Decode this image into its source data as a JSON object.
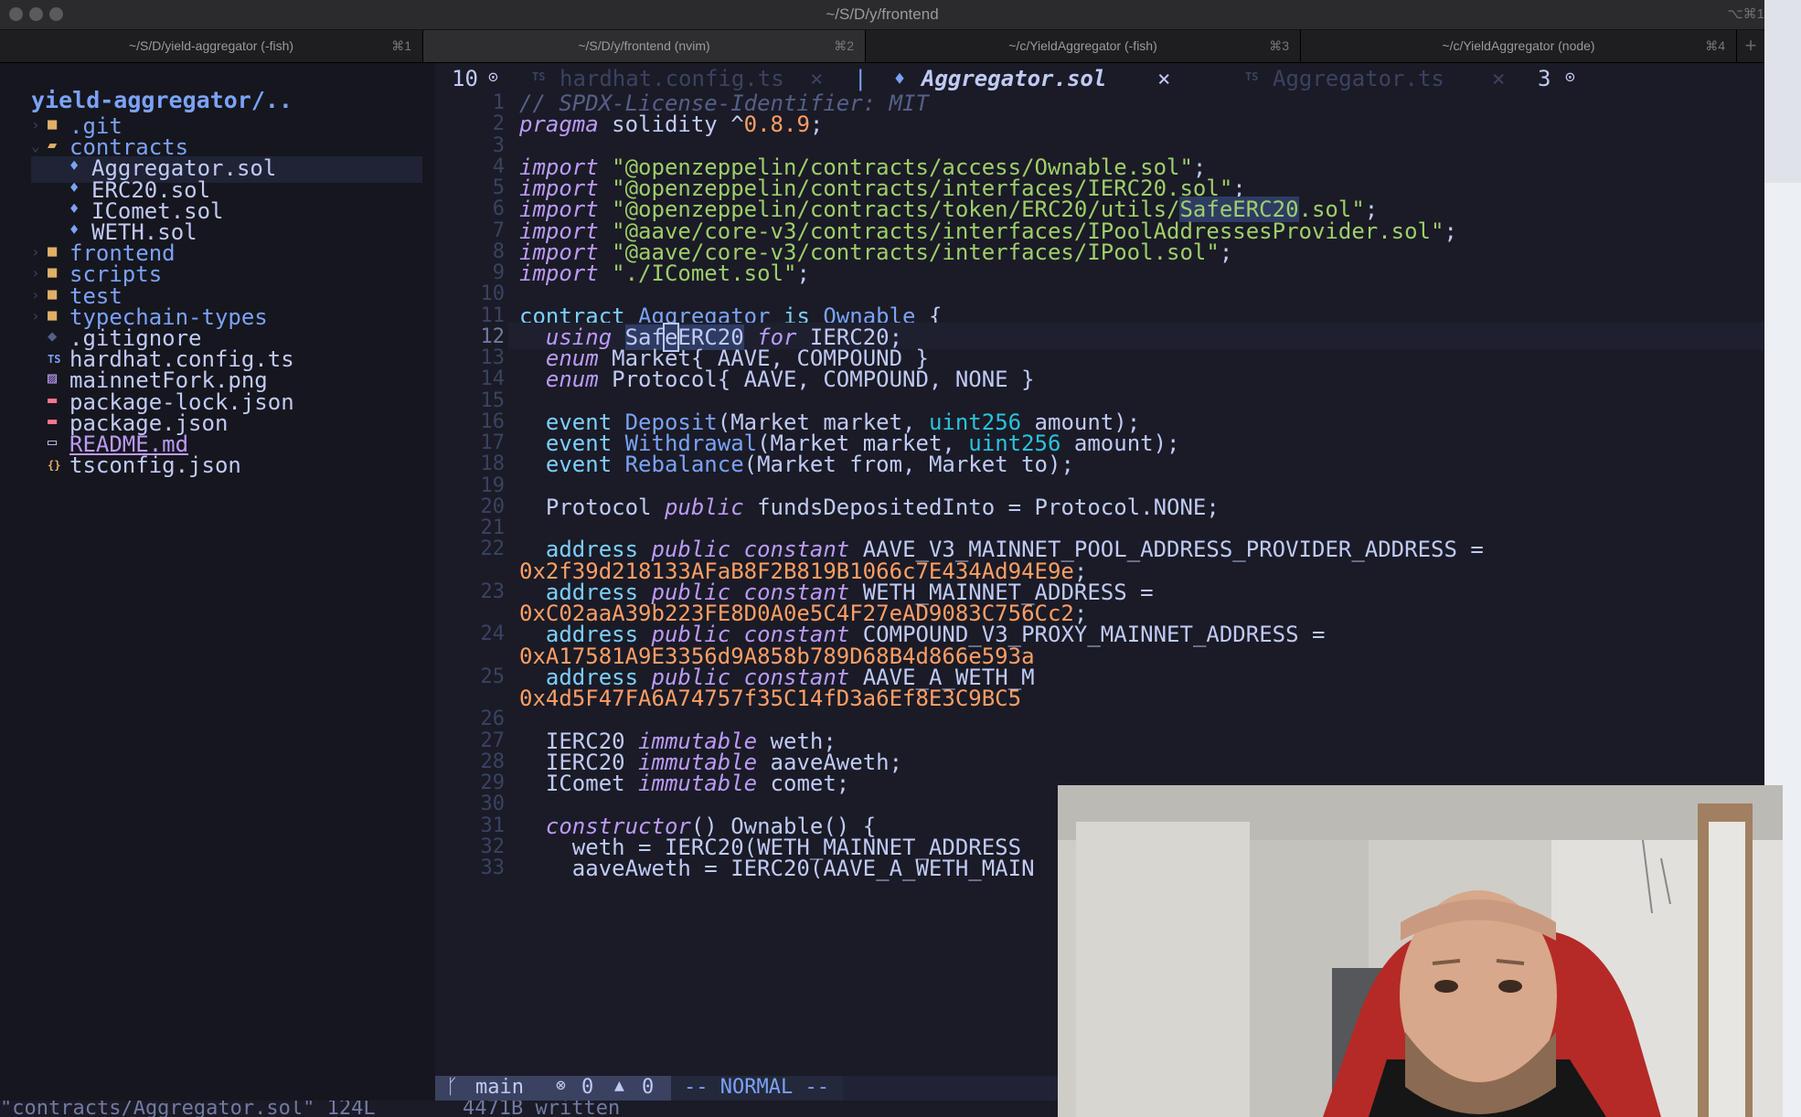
{
  "window": {
    "title": "~/S/D/y/frontend",
    "shortcut": "⌥⌘1"
  },
  "terminal_tabs": [
    {
      "label": "~/S/D/yield-aggregator (-fish)",
      "key": "⌘1"
    },
    {
      "label": "~/S/D/y/frontend (nvim)",
      "key": "⌘2"
    },
    {
      "label": "~/c/YieldAggregator (-fish)",
      "key": "⌘3"
    },
    {
      "label": "~/c/YieldAggregator (node)",
      "key": "⌘4"
    }
  ],
  "new_tab": "+",
  "sidebar": {
    "root": "yield-aggregator/..",
    "items": [
      {
        "name": ".git",
        "type": "folder",
        "chev": "›"
      },
      {
        "name": "contracts",
        "type": "folder-open",
        "chev": "⌄"
      },
      {
        "name": "Aggregator.sol",
        "type": "sol",
        "selected": true
      },
      {
        "name": "ERC20.sol",
        "type": "sol"
      },
      {
        "name": "IComet.sol",
        "type": "sol"
      },
      {
        "name": "WETH.sol",
        "type": "sol"
      },
      {
        "name": "frontend",
        "type": "folder",
        "chev": "›"
      },
      {
        "name": "scripts",
        "type": "folder",
        "chev": "›"
      },
      {
        "name": "test",
        "type": "folder",
        "chev": "›"
      },
      {
        "name": "typechain-types",
        "type": "folder",
        "chev": "›"
      },
      {
        "name": ".gitignore",
        "type": "git"
      },
      {
        "name": "hardhat.config.ts",
        "type": "ts"
      },
      {
        "name": "mainnetFork.png",
        "type": "png"
      },
      {
        "name": "package-lock.json",
        "type": "npm"
      },
      {
        "name": "package.json",
        "type": "npm"
      },
      {
        "name": "README.md",
        "type": "md"
      },
      {
        "name": "tsconfig.json",
        "type": "json"
      }
    ]
  },
  "buffers": {
    "left_count": "10",
    "left_icon": "arrow-circle-icon",
    "tab1": {
      "icon": "TS",
      "name": "hardhat.config.ts",
      "close": "×"
    },
    "tab2": {
      "name": "Aggregator.sol",
      "close": "×"
    },
    "tab3": {
      "icon": "TS",
      "name": "Aggregator.ts",
      "close": "×"
    },
    "right_count": "3",
    "separator": "|"
  },
  "code": {
    "current_line": 12,
    "lines": [
      {
        "n": "1",
        "segs": [
          [
            "cm",
            "// SPDX-License-Identifier: MIT"
          ]
        ]
      },
      {
        "n": "2",
        "segs": [
          [
            "kw",
            "pragma"
          ],
          [
            "",
            " solidity ^"
          ],
          [
            "num",
            "0.8.9"
          ],
          [
            "",
            ";"
          ]
        ]
      },
      {
        "n": "3",
        "segs": []
      },
      {
        "n": "4",
        "segs": [
          [
            "kw",
            "import"
          ],
          [
            "",
            " "
          ],
          [
            "str",
            "\"@openzeppelin/contracts/access/Ownable.sol\""
          ],
          [
            "",
            ";"
          ]
        ]
      },
      {
        "n": "5",
        "segs": [
          [
            "kw",
            "import"
          ],
          [
            "",
            " "
          ],
          [
            "str",
            "\"@openzeppelin/contracts/interfaces/IERC20.sol\""
          ],
          [
            "",
            ";"
          ]
        ]
      },
      {
        "n": "6",
        "segs": [
          [
            "kw",
            "import"
          ],
          [
            "",
            " "
          ],
          [
            "str",
            "\"@openzeppelin/contracts/token/ERC20/utils/"
          ],
          [
            "str hl",
            "SafeERC20"
          ],
          [
            "str",
            ".sol\""
          ],
          [
            "",
            ";"
          ]
        ]
      },
      {
        "n": "7",
        "segs": [
          [
            "kw",
            "import"
          ],
          [
            "",
            " "
          ],
          [
            "str",
            "\"@aave/core-v3/contracts/interfaces/IPoolAddressesProvider.sol\""
          ],
          [
            "",
            ";"
          ]
        ]
      },
      {
        "n": "8",
        "segs": [
          [
            "kw",
            "import"
          ],
          [
            "",
            " "
          ],
          [
            "str",
            "\"@aave/core-v3/contracts/interfaces/IPool.sol\""
          ],
          [
            "",
            ";"
          ]
        ]
      },
      {
        "n": "9",
        "segs": [
          [
            "kw",
            "import"
          ],
          [
            "",
            " "
          ],
          [
            "str",
            "\"./IComet.sol\""
          ],
          [
            "",
            ";"
          ]
        ]
      },
      {
        "n": "10",
        "segs": []
      },
      {
        "n": "11",
        "segs": [
          [
            "kw2",
            "contract"
          ],
          [
            "",
            " "
          ],
          [
            "ev",
            "Aggregator"
          ],
          [
            "",
            " "
          ],
          [
            "kw2",
            "is"
          ],
          [
            "",
            " "
          ],
          [
            "ev",
            "Ownable"
          ],
          [
            "",
            " {"
          ]
        ]
      },
      {
        "n": "12",
        "segs": [
          [
            "",
            "  "
          ],
          [
            "kw",
            "using"
          ],
          [
            "",
            " "
          ],
          [
            "hl",
            "Saf"
          ],
          [
            "hl cursor",
            "e"
          ],
          [
            "hl",
            "ERC20"
          ],
          [
            "",
            " "
          ],
          [
            "kw",
            "for"
          ],
          [
            "",
            " IERC20;"
          ]
        ]
      },
      {
        "n": "13",
        "segs": [
          [
            "",
            "  "
          ],
          [
            "kw",
            "enum"
          ],
          [
            "",
            " Market{ AAVE, COMPOUND }"
          ]
        ]
      },
      {
        "n": "14",
        "segs": [
          [
            "",
            "  "
          ],
          [
            "kw",
            "enum"
          ],
          [
            "",
            " Protocol{ AAVE, COMPOUND, NONE }"
          ]
        ]
      },
      {
        "n": "15",
        "segs": []
      },
      {
        "n": "16",
        "segs": [
          [
            "",
            "  "
          ],
          [
            "kw2",
            "event"
          ],
          [
            "",
            " "
          ],
          [
            "ev",
            "Deposit"
          ],
          [
            "",
            "(Market market, "
          ],
          [
            "ty",
            "uint256"
          ],
          [
            "",
            " amount);"
          ]
        ]
      },
      {
        "n": "17",
        "segs": [
          [
            "",
            "  "
          ],
          [
            "kw2",
            "event"
          ],
          [
            "",
            " "
          ],
          [
            "ev",
            "Withdrawal"
          ],
          [
            "",
            "(Market market, "
          ],
          [
            "ty",
            "uint256"
          ],
          [
            "",
            " amount);"
          ]
        ]
      },
      {
        "n": "18",
        "segs": [
          [
            "",
            "  "
          ],
          [
            "kw2",
            "event"
          ],
          [
            "",
            " "
          ],
          [
            "ev",
            "Rebalance"
          ],
          [
            "",
            "(Market from, Market to);"
          ]
        ]
      },
      {
        "n": "19",
        "segs": []
      },
      {
        "n": "20",
        "segs": [
          [
            "",
            "  Protocol "
          ],
          [
            "kw",
            "public"
          ],
          [
            "",
            " fundsDepositedInto = Protocol.NONE;"
          ]
        ]
      },
      {
        "n": "21",
        "segs": []
      },
      {
        "n": "22",
        "segs": [
          [
            "",
            "  "
          ],
          [
            "kw2",
            "address"
          ],
          [
            "",
            " "
          ],
          [
            "kw",
            "public constant"
          ],
          [
            "",
            " AAVE_V3_MAINNET_POOL_ADDRESS_PROVIDER_ADDRESS ="
          ]
        ]
      },
      {
        "n": "",
        "segs": [
          [
            "num",
            "0x2f39d218133AFaB8F2B819B1066c7E434Ad94E9e"
          ],
          [
            "",
            ";"
          ]
        ]
      },
      {
        "n": "23",
        "segs": [
          [
            "",
            "  "
          ],
          [
            "kw2",
            "address"
          ],
          [
            "",
            " "
          ],
          [
            "kw",
            "public constant"
          ],
          [
            "",
            " WETH_MAINNET_ADDRESS ="
          ]
        ]
      },
      {
        "n": "",
        "segs": [
          [
            "num",
            "0xC02aaA39b223FE8D0A0e5C4F27eAD9083C756Cc2"
          ],
          [
            "",
            ";"
          ]
        ]
      },
      {
        "n": "24",
        "segs": [
          [
            "",
            "  "
          ],
          [
            "kw2",
            "address"
          ],
          [
            "",
            " "
          ],
          [
            "kw",
            "public constant"
          ],
          [
            "",
            " COMPOUND_V3_PROXY_MAINNET_ADDRESS ="
          ]
        ]
      },
      {
        "n": "",
        "segs": [
          [
            "num",
            "0xA17581A9E3356d9A858b789D68B4d866e593a"
          ]
        ]
      },
      {
        "n": "25",
        "segs": [
          [
            "",
            "  "
          ],
          [
            "kw2",
            "address"
          ],
          [
            "",
            " "
          ],
          [
            "kw",
            "public constant"
          ],
          [
            "",
            " AAVE_A_WETH_M"
          ]
        ]
      },
      {
        "n": "",
        "segs": [
          [
            "num",
            "0x4d5F47FA6A74757f35C14fD3a6Ef8E3C9BC5"
          ]
        ]
      },
      {
        "n": "26",
        "segs": []
      },
      {
        "n": "27",
        "segs": [
          [
            "",
            "  IERC20 "
          ],
          [
            "kw",
            "immutable"
          ],
          [
            "",
            " weth;"
          ]
        ]
      },
      {
        "n": "28",
        "segs": [
          [
            "",
            "  IERC20 "
          ],
          [
            "kw",
            "immutable"
          ],
          [
            "",
            " aaveAweth;"
          ]
        ]
      },
      {
        "n": "29",
        "segs": [
          [
            "",
            "  IComet "
          ],
          [
            "kw",
            "immutable"
          ],
          [
            "",
            " comet;"
          ]
        ]
      },
      {
        "n": "30",
        "segs": []
      },
      {
        "n": "31",
        "segs": [
          [
            "",
            "  "
          ],
          [
            "kw",
            "constructor"
          ],
          [
            "",
            "() Ownable() {"
          ]
        ]
      },
      {
        "n": "32",
        "segs": [
          [
            "",
            "    weth = IERC20(WETH_MAINNET_ADDRESS"
          ]
        ]
      },
      {
        "n": "33",
        "segs": [
          [
            "",
            "    aaveAweth = IERC20(AAVE_A_WETH_MAIN"
          ]
        ]
      }
    ]
  },
  "status": {
    "branch_icon": "git-branch-icon",
    "branch": "main",
    "errors": "0",
    "warnings": "0",
    "mode": "-- NORMAL --"
  },
  "cmdline": {
    "file": "\"contracts/Aggregator.sol\" 124L",
    "written": "4471B written"
  },
  "webcam": {
    "description_icon": "webcam-person-icon"
  }
}
